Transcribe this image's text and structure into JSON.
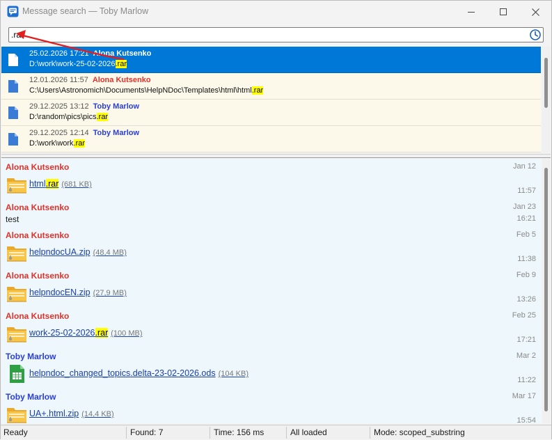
{
  "window": {
    "title": "Message search — Toby Marlow"
  },
  "search": {
    "value": ".rar"
  },
  "colors": {
    "selected": "#0078d7",
    "highlight": "#ffff00",
    "author_red": "#e0332b",
    "author_blue": "#2a3fd6"
  },
  "results": [
    {
      "date": "25.02.2026 17:21",
      "author": "Alona Kutsenko",
      "path_pre": "D:\\work\\work-25-02-2026",
      "match": ".rar",
      "color": "red",
      "selected": true
    },
    {
      "date": "12.01.2026 11:57",
      "author": "Alona Kutsenko",
      "path_pre": "C:\\Users\\Astronomich\\Documents\\HelpNDoc\\Templates\\html\\html",
      "match": ".rar",
      "color": "red",
      "selected": false
    },
    {
      "date": "29.12.2025 13:12",
      "author": "Toby Marlow",
      "path_pre": "D:\\random\\pics\\pics",
      "match": ".rar",
      "color": "blue",
      "selected": false
    },
    {
      "date": "29.12.2025 12:14",
      "author": "Toby Marlow",
      "path_pre": "D:\\work\\work",
      "match": ".rar",
      "color": "blue",
      "selected": false
    }
  ],
  "messages": [
    {
      "sender": "Alona Kutsenko",
      "color": "red",
      "day": "Jan 12",
      "time": "11:57",
      "name_pre": "html",
      "match": ".rar",
      "name_post": "",
      "size": "(681 KB)",
      "icon": "archive-folder-icon"
    },
    {
      "sender": "Alona Kutsenko",
      "color": "red",
      "day": "Jan 23",
      "time": "16:21",
      "text": "test"
    },
    {
      "sender": "Alona Kutsenko",
      "color": "red",
      "day": "Feb 5",
      "time": "11:38",
      "name_pre": "helpndocUA.zip",
      "match": "",
      "name_post": "",
      "size": "(48,4 MB)",
      "icon": "archive-folder-icon"
    },
    {
      "sender": "Alona Kutsenko",
      "color": "red",
      "day": "Feb 9",
      "time": "13:26",
      "name_pre": "helpndocEN.zip",
      "match": "",
      "name_post": "",
      "size": "(27,9 MB)",
      "icon": "archive-folder-icon"
    },
    {
      "sender": "Alona Kutsenko",
      "color": "red",
      "day": "Feb 25",
      "time": "17:21",
      "name_pre": "work-25-02-2026",
      "match": ".rar",
      "name_post": "",
      "size": "(100 MB)",
      "icon": "archive-folder-icon"
    },
    {
      "sender": "Toby Marlow",
      "color": "blue",
      "day": "Mar 2",
      "time": "11:22",
      "name_pre": "helpndoc_changed_topics.delta-23-02-2026.ods",
      "match": "",
      "name_post": "",
      "size": "(104 KB)",
      "icon": "spreadsheet-icon"
    },
    {
      "sender": "Toby Marlow",
      "color": "blue",
      "day": "Mar 17",
      "time": "15:54",
      "name_pre": "UA+.html.zip",
      "match": "",
      "name_post": "",
      "size": "(14,4 KB)",
      "icon": "archive-folder-icon"
    }
  ],
  "status": {
    "state": "Ready",
    "found": "Found: 7",
    "time": "Time: 156 ms",
    "loaded": "All loaded",
    "mode": "Mode: scoped_substring"
  }
}
